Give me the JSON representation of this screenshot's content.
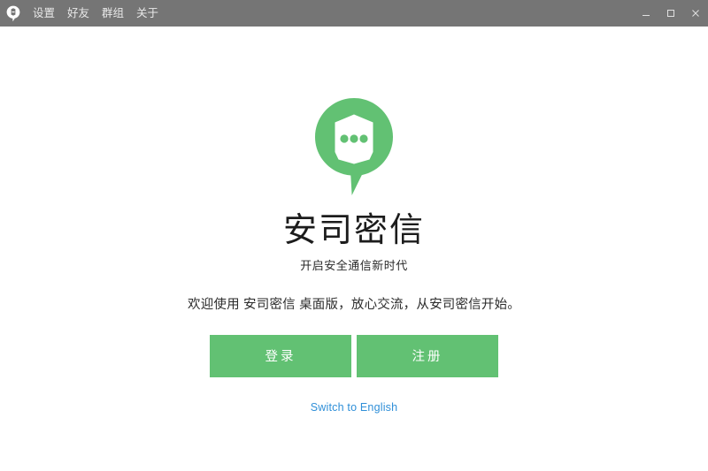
{
  "window": {
    "app_icon": "speech-bubble-icon",
    "menu": [
      {
        "label": "设置",
        "name": "settings"
      },
      {
        "label": "好友",
        "name": "friends"
      },
      {
        "label": "群组",
        "name": "groups"
      },
      {
        "label": "关于",
        "name": "about"
      }
    ],
    "controls": {
      "minimize": "minimize-icon",
      "maximize": "maximize-icon",
      "close": "close-icon"
    },
    "titlebar_color": "#757575",
    "menu_text_color": "#e8e8e8"
  },
  "main": {
    "logo": {
      "name": "app-logo",
      "shape": "speech-bubble-with-shield",
      "color": "#62c173",
      "inner_color": "#ffffff",
      "dots": 3
    },
    "brand_title": "安司密信",
    "brand_subtitle": "开启安全通信新时代",
    "welcome_text": "欢迎使用 安司密信 桌面版，放心交流，从安司密信开始。",
    "buttons": [
      {
        "label": "登录",
        "name": "login"
      },
      {
        "label": "注册",
        "name": "register"
      }
    ],
    "switch_language_link": "Switch to English",
    "accent_color": "#62c173",
    "link_color": "#2f8fd8",
    "background_color": "#ffffff"
  }
}
